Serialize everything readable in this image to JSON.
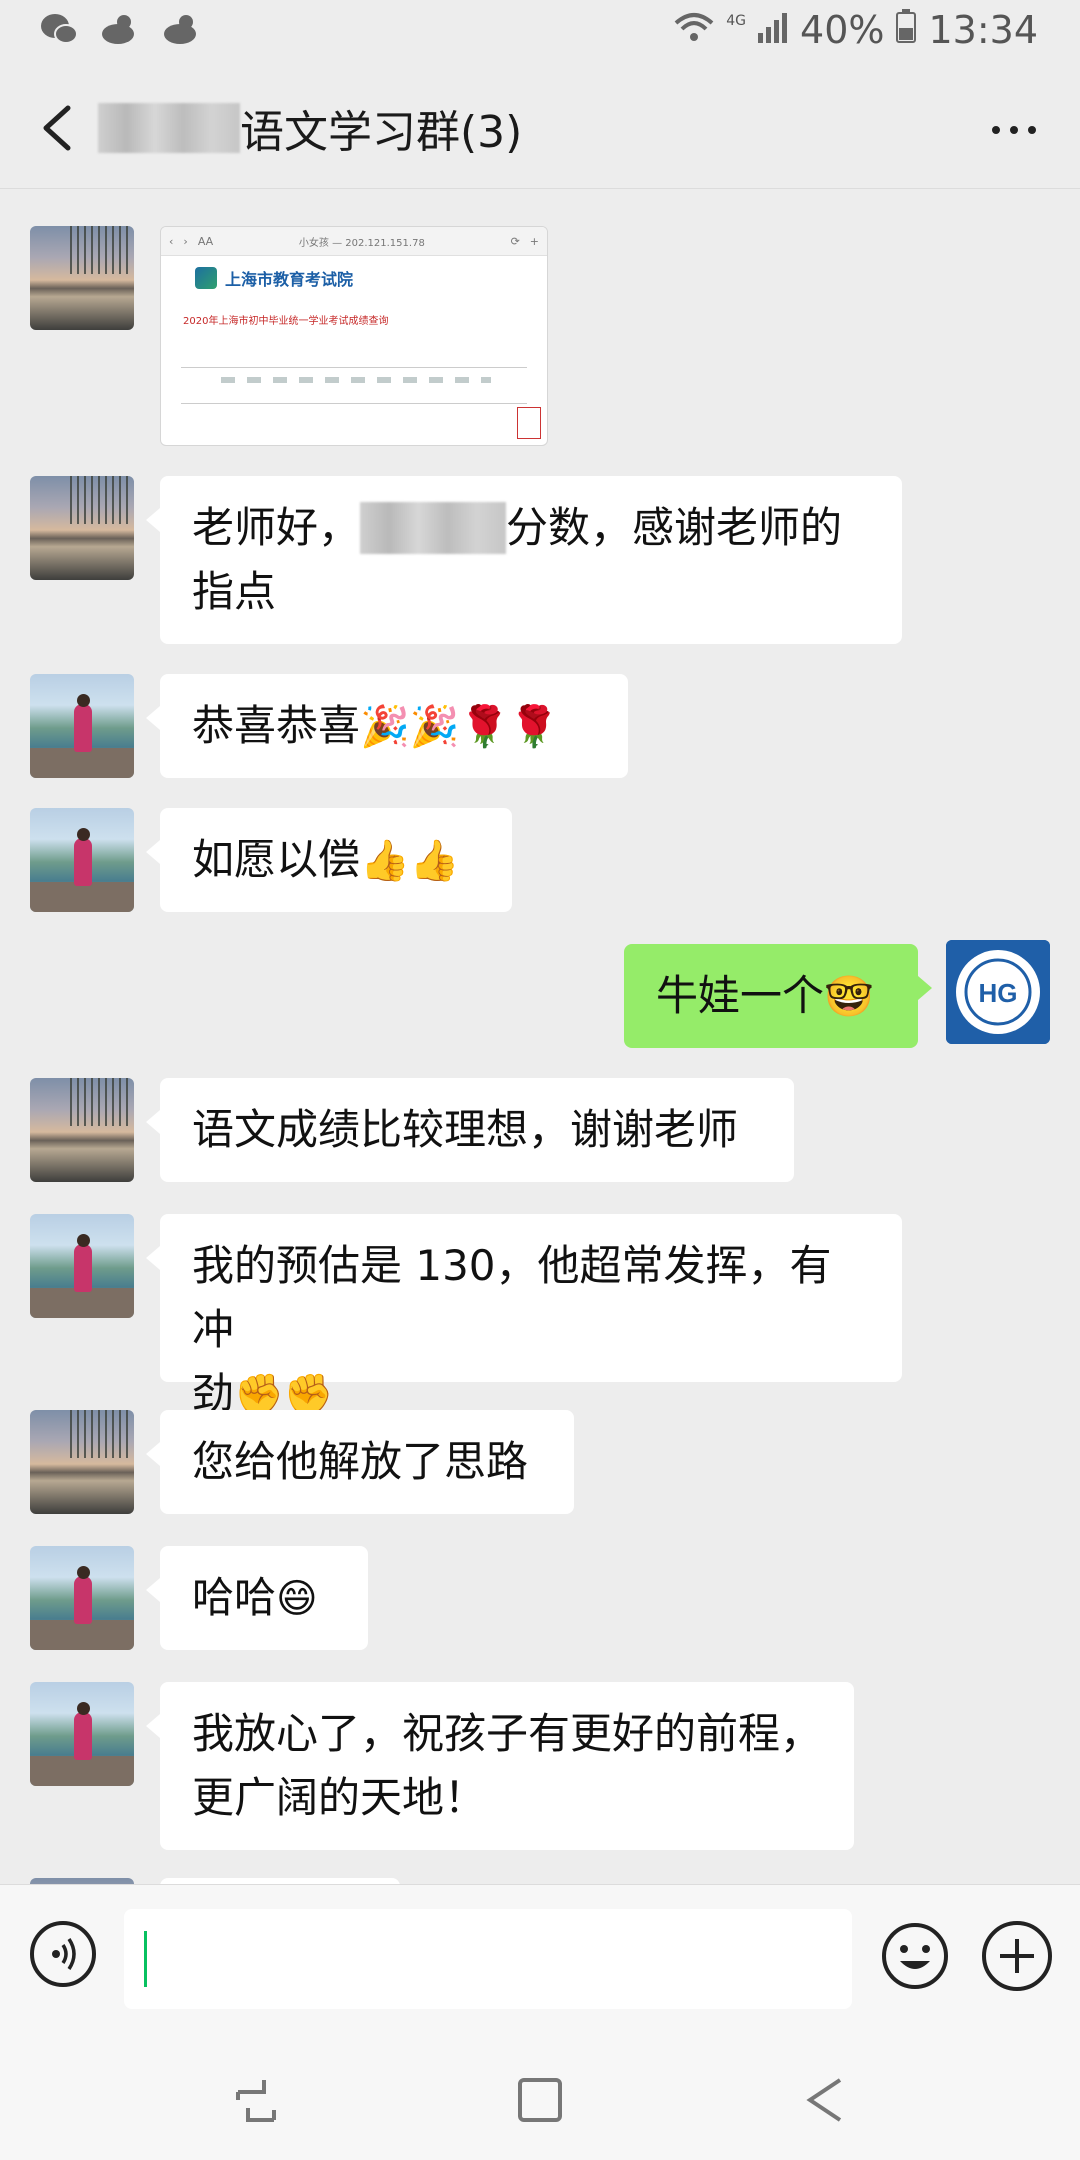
{
  "status_bar": {
    "network": "4G",
    "battery": "40%",
    "time": "13:34",
    "left_icons": [
      "wechat-icon",
      "weather-icon",
      "weather-icon"
    ]
  },
  "header": {
    "title": "语文学习群(3)",
    "back_icon": "chevron-left-icon",
    "more_icon": "more-dots-icon"
  },
  "thumbnail": {
    "url": "小女孩 — 202.121.151.78",
    "aa": "AA",
    "org": "上海市教育考试院",
    "headline": "2020年上海市初中毕业统一学业考试成绩查询"
  },
  "messages": [
    {
      "side": "left",
      "avatar": "sunset",
      "parts": [
        "老师好，",
        "分数，感谢老师的",
        "指点"
      ]
    },
    {
      "side": "left",
      "avatar": "lake",
      "text": "恭喜恭喜",
      "emoji": "🎉🎉🌹🌹"
    },
    {
      "side": "left",
      "avatar": "lake",
      "text": "如愿以偿",
      "emoji": "👍👍"
    },
    {
      "side": "right",
      "avatar": "self",
      "text": "牛娃一个",
      "emoji": "🤓"
    },
    {
      "side": "left",
      "avatar": "sunset",
      "text": "语文成绩比较理想，谢谢老师"
    },
    {
      "side": "left",
      "avatar": "lake",
      "line1": "我的预估是 130，他超常发挥，有冲",
      "line2": "劲",
      "emoji": "✊✊"
    },
    {
      "side": "left",
      "avatar": "sunset",
      "text": "您给他解放了思路"
    },
    {
      "side": "left",
      "avatar": "lake",
      "text": "哈哈",
      "emoji": "😄"
    },
    {
      "side": "left",
      "avatar": "lake",
      "line1": "我放心了，祝孩子有更好的前程，",
      "line2": "更广阔的天地！"
    }
  ],
  "self_avatar_text": "HG",
  "input": {
    "value": "",
    "voice_icon": "voice-icon",
    "emoji_icon": "emoji-icon",
    "plus_icon": "plus-icon"
  },
  "nav": [
    "recent-apps-icon",
    "home-icon",
    "back-icon"
  ]
}
